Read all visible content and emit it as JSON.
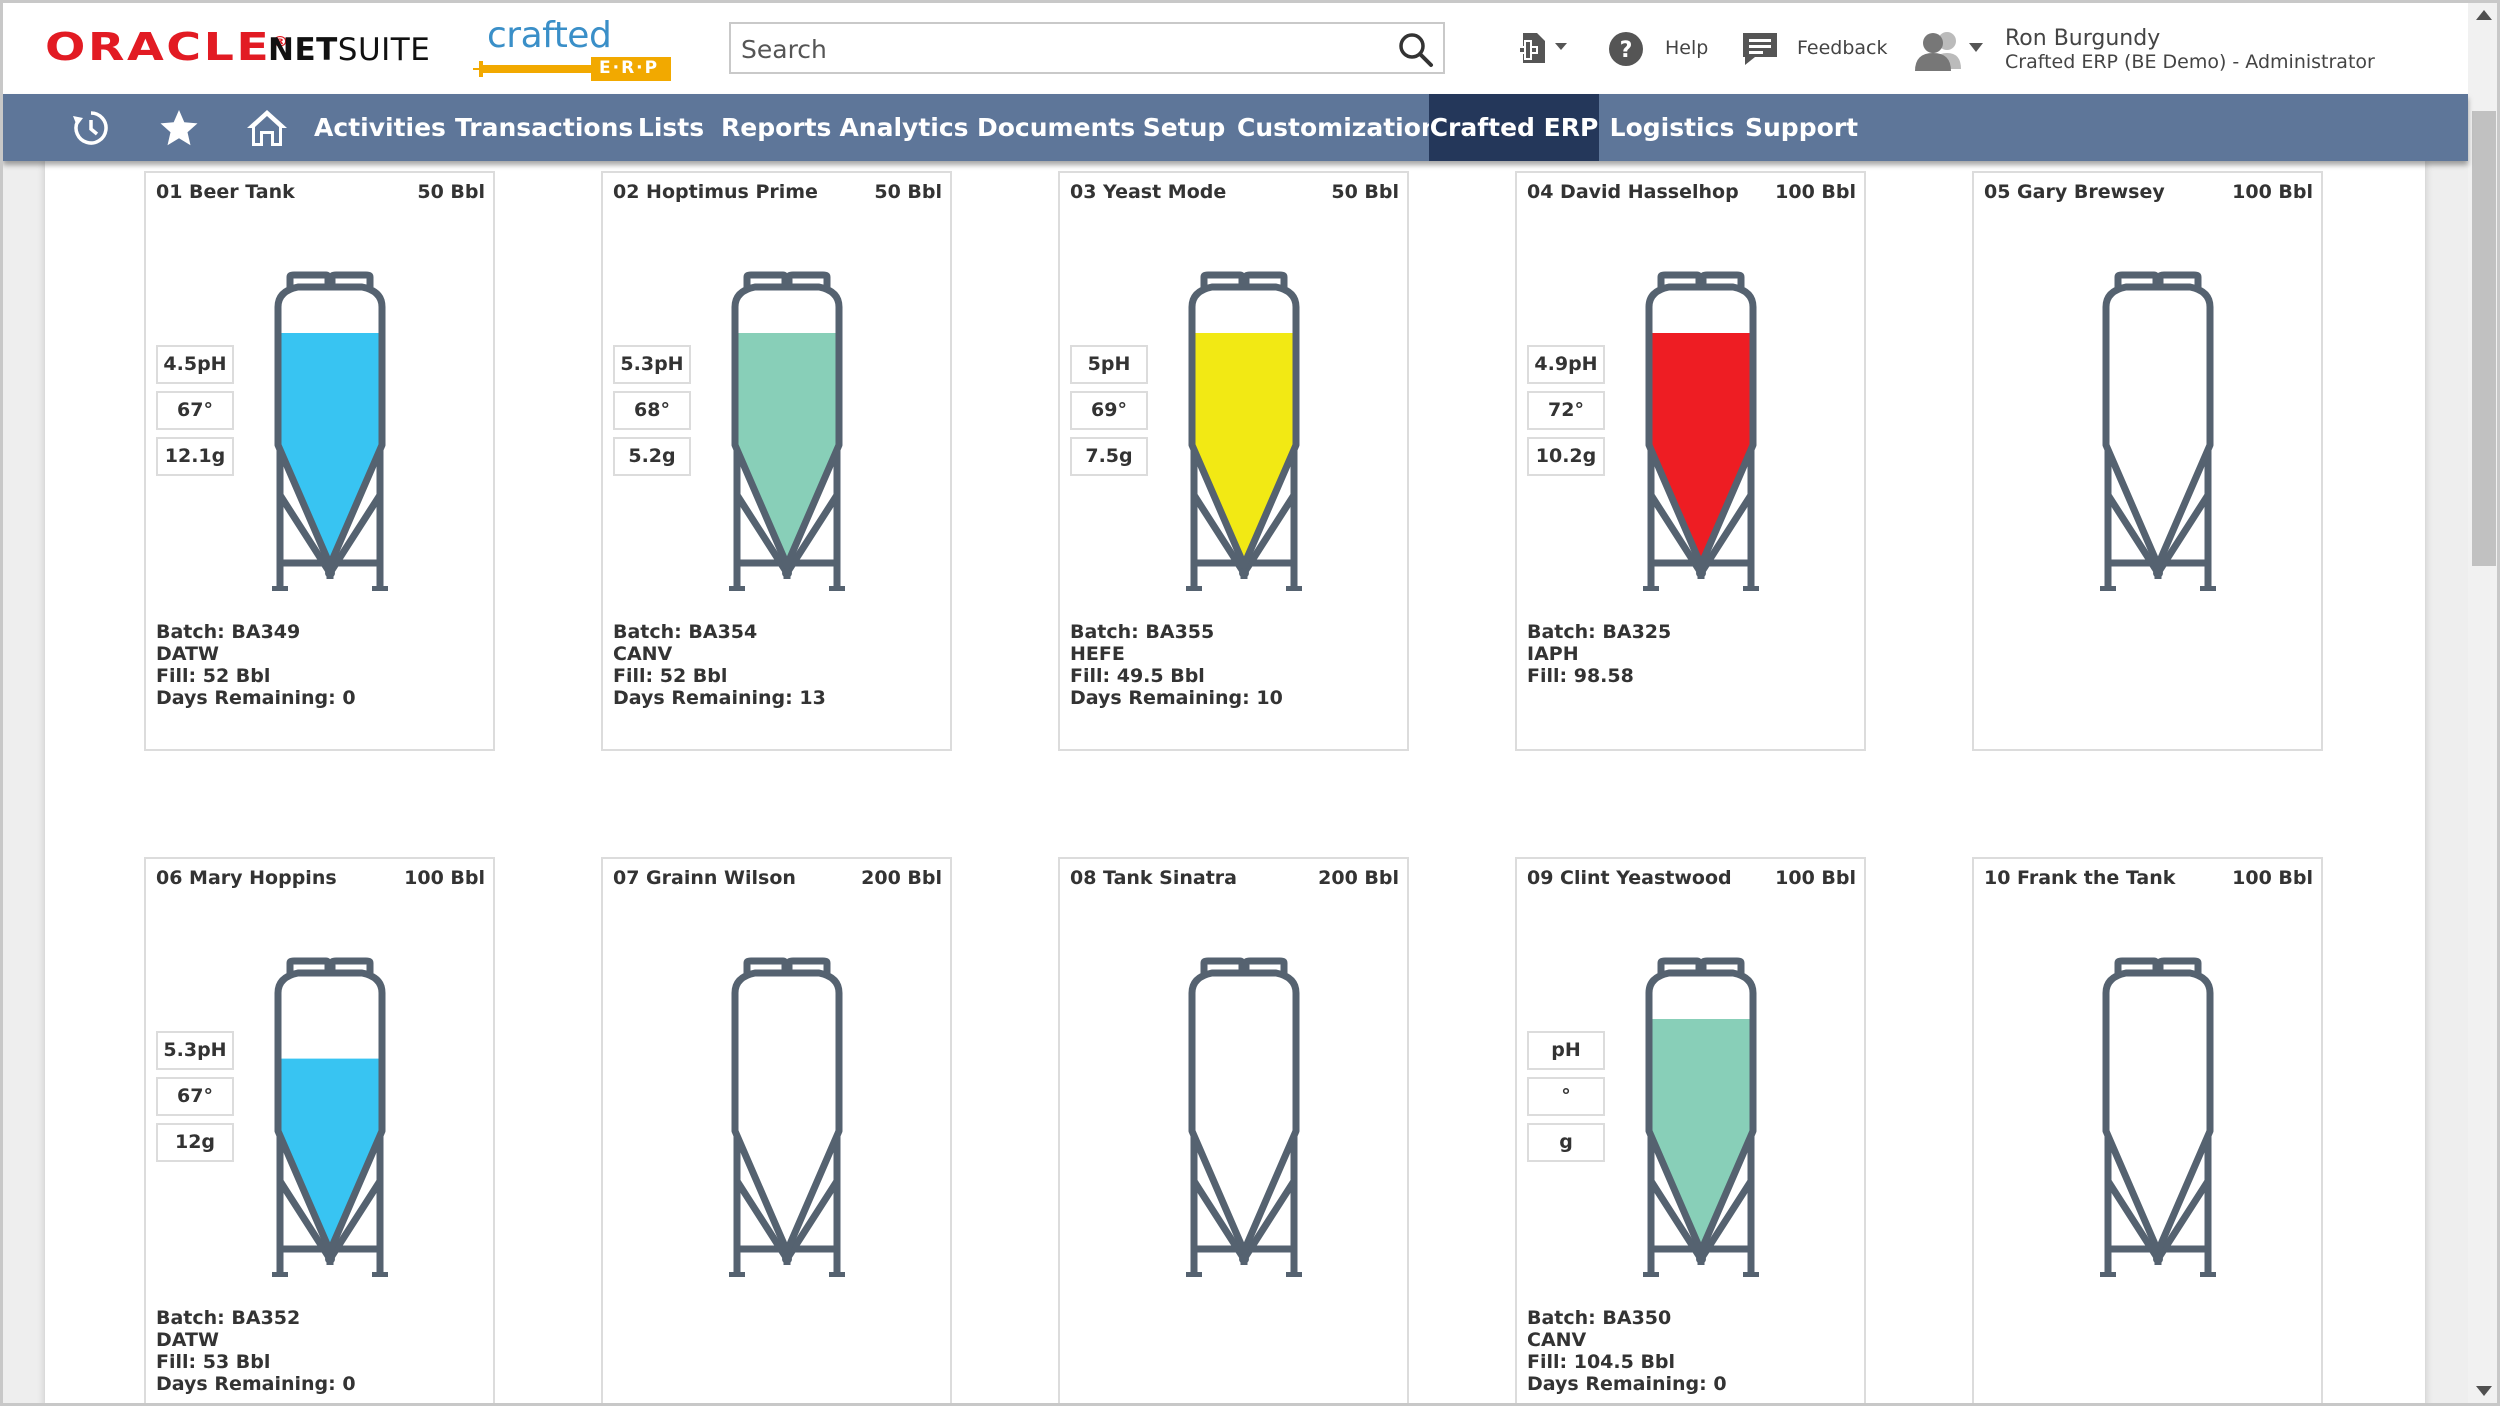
{
  "header": {
    "brand_oracle": "ORACLE",
    "brand_netsuite_bold": "NET",
    "brand_netsuite": "SUITE",
    "brand_crafted": "crafted",
    "brand_erp": "E·R·P",
    "search_placeholder": "Search",
    "help_label": "Help",
    "feedback_label": "Feedback",
    "user_name": "Ron Burgundy",
    "user_role": "Crafted ERP (BE Demo) - Administrator"
  },
  "nav": {
    "items": [
      "Activities",
      "Transactions",
      "Lists",
      "Reports",
      "Analytics",
      "Documents",
      "Setup",
      "Customization",
      "Crafted ERP",
      "Logistics",
      "Support"
    ],
    "active": "Crafted ERP"
  },
  "colors": {
    "nav_bg": "#5e7699",
    "nav_active": "#24375a",
    "tank_outline": "#556270",
    "blue": "#38c4f2",
    "green": "#88cfb8",
    "yellow": "#f2e914",
    "red": "#ee1d23"
  },
  "tanks": [
    {
      "name": "01 Beer Tank",
      "capacity": "50 Bbl",
      "fill_fraction": 0.82,
      "color": "#38c4f2",
      "readings": [
        "4.5pH",
        "67°",
        "12.1g"
      ],
      "info": [
        "Batch: BA349",
        "DATW",
        "Fill: 52 Bbl",
        "Days Remaining: 0"
      ]
    },
    {
      "name": "02 Hoptimus Prime",
      "capacity": "50 Bbl",
      "fill_fraction": 0.82,
      "color": "#88cfb8",
      "readings": [
        "5.3pH",
        "68°",
        "5.2g"
      ],
      "info": [
        "Batch: BA354",
        "CANV",
        "Fill: 52 Bbl",
        "Days Remaining: 13"
      ]
    },
    {
      "name": "03 Yeast Mode",
      "capacity": "50 Bbl",
      "fill_fraction": 0.82,
      "color": "#f2e914",
      "readings": [
        "5pH",
        "69°",
        "7.5g"
      ],
      "info": [
        "Batch: BA355",
        "HEFE",
        "Fill: 49.5 Bbl",
        "Days Remaining: 10"
      ]
    },
    {
      "name": "04 David Hasselhop",
      "capacity": "100 Bbl",
      "fill_fraction": 0.82,
      "color": "#ee1d23",
      "readings": [
        "4.9pH",
        "72°",
        "10.2g"
      ],
      "info": [
        "Batch: BA325",
        "IAPH",
        "Fill: 98.58"
      ]
    },
    {
      "name": "05 Gary Brewsey",
      "capacity": "100 Bbl",
      "fill_fraction": 0,
      "color": "",
      "readings": [],
      "info": []
    },
    {
      "name": "06 Mary Hoppins",
      "capacity": "100 Bbl",
      "fill_fraction": 0.68,
      "color": "#38c4f2",
      "readings": [
        "5.3pH",
        "67°",
        "12g"
      ],
      "info": [
        "Batch: BA352",
        "DATW",
        "Fill: 53 Bbl",
        "Days Remaining: 0"
      ]
    },
    {
      "name": "07 Grainn Wilson",
      "capacity": "200 Bbl",
      "fill_fraction": 0,
      "color": "",
      "readings": [],
      "info": []
    },
    {
      "name": "08 Tank Sinatra",
      "capacity": "200 Bbl",
      "fill_fraction": 0,
      "color": "",
      "readings": [],
      "info": []
    },
    {
      "name": "09 Clint Yeastwood",
      "capacity": "100 Bbl",
      "fill_fraction": 0.82,
      "color": "#88cfb8",
      "readings": [
        "pH",
        "°",
        "g"
      ],
      "info": [
        "Batch: BA350",
        "CANV",
        "Fill: 104.5 Bbl",
        "Days Remaining: 0"
      ]
    },
    {
      "name": "10 Frank the Tank",
      "capacity": "100 Bbl",
      "fill_fraction": 0,
      "color": "",
      "readings": [],
      "info": []
    }
  ]
}
